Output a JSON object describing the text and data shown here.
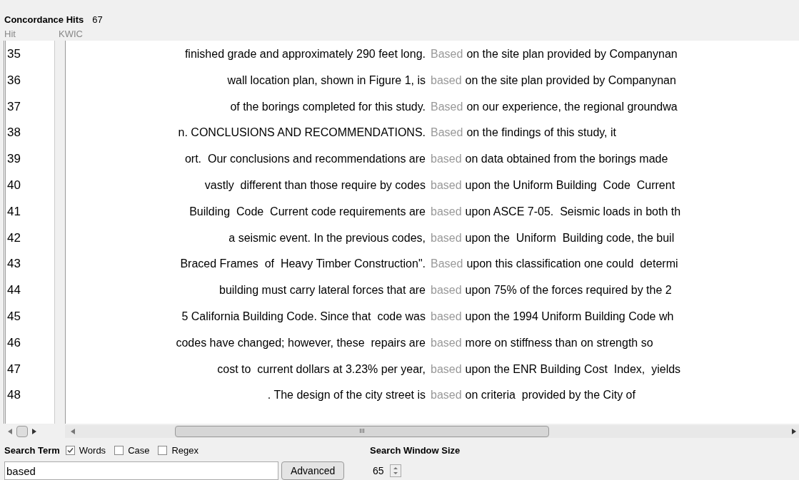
{
  "header": {
    "title": "Concordance Hits",
    "count": "67"
  },
  "columns": [
    "Hit",
    "KWIC"
  ],
  "rows": [
    {
      "hit": "35",
      "left": "finished grade and approximately 290 feet long.",
      "keyword": "Based",
      "right": "on the site plan provided by Companynan"
    },
    {
      "hit": "36",
      "left": "wall location plan, shown in Figure 1, is",
      "keyword": "based",
      "right": "on the site plan provided by Companynan"
    },
    {
      "hit": "37",
      "left": "of the borings completed for this study.",
      "keyword": "Based",
      "right": "on our experience, the regional groundwa"
    },
    {
      "hit": "38",
      "left": "n. CONCLUSIONS AND RECOMMENDATIONS.",
      "keyword": "Based",
      "right": "on the findings of this study, it"
    },
    {
      "hit": "39",
      "left": "ort.  Our conclusions and recommendations are",
      "keyword": "based",
      "right": "on data obtained from the borings made"
    },
    {
      "hit": "40",
      "left": "vastly  different than those require by codes",
      "keyword": "based",
      "right": "upon the Uniform Building  Code  Current"
    },
    {
      "hit": "41",
      "left": "Building  Code  Current code requirements are",
      "keyword": "based",
      "right": "upon ASCE 7-05.  Seismic loads in both th"
    },
    {
      "hit": "42",
      "left": "a seismic event. In the previous codes,",
      "keyword": "based",
      "right": "upon the  Uniform  Building code, the buil"
    },
    {
      "hit": "43",
      "left": "Braced Frames  of  Heavy Timber Construction\".",
      "keyword": "Based",
      "right": "upon this classification one could  determi"
    },
    {
      "hit": "44",
      "left": "building must carry lateral forces that are",
      "keyword": "based",
      "right": "upon 75% of the forces required by the 2"
    },
    {
      "hit": "45",
      "left": "5 California Building Code. Since that  code was",
      "keyword": "based",
      "right": "upon the 1994 Uniform Building Code wh"
    },
    {
      "hit": "46",
      "left": "codes have changed; however, these  repairs are",
      "keyword": "based",
      "right": "more on stiffness than on strength so"
    },
    {
      "hit": "47",
      "left": "cost to  current dollars at 3.23% per year,",
      "keyword": "based",
      "right": "upon the ENR Building Cost  Index,  yields"
    },
    {
      "hit": "48",
      "left": ". The design of the city street is",
      "keyword": "based",
      "right": "on criteria  provided by the City of"
    }
  ],
  "scrollbar_center": "III",
  "search": {
    "label": "Search Term",
    "options": [
      {
        "label": "Words",
        "checked": true
      },
      {
        "label": "Case",
        "checked": false
      },
      {
        "label": "Regex",
        "checked": false
      }
    ],
    "value": "based",
    "button": "Advanced"
  },
  "window_size": {
    "label": "Search Window Size",
    "value": "65"
  }
}
